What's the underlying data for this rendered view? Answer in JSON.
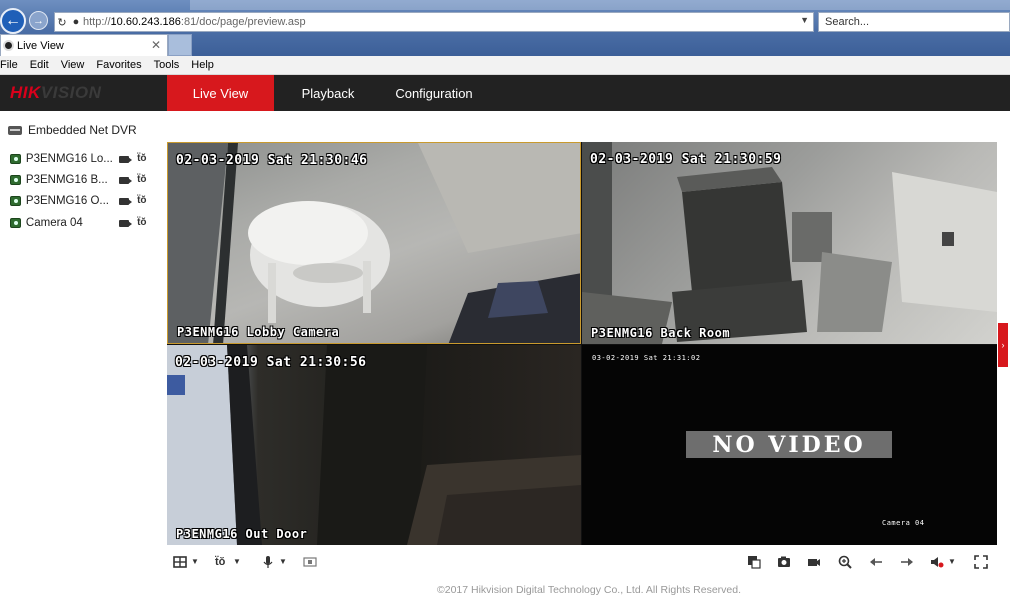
{
  "browser": {
    "url_prefix": "http://",
    "url_host": "10.60.243.186",
    "url_suffix": ":81/doc/page/preview.asp",
    "search_placeholder": "Search...",
    "tab_title": "Live View",
    "tab_close": "✕",
    "menu": [
      "File",
      "Edit",
      "View",
      "Favorites",
      "Tools",
      "Help"
    ]
  },
  "app": {
    "logo_part1": "HIK",
    "logo_part2": "VISION",
    "tabs": [
      "Live View",
      "Playback",
      "Configuration"
    ],
    "active_tab": "Live View",
    "accent_color": "#d7181d"
  },
  "sidebar": {
    "device": "Embedded Net DVR",
    "cameras": [
      {
        "label": "P3ENMG16 Lo..."
      },
      {
        "label": "P3ENMG16 B..."
      },
      {
        "label": "P3ENMG16 O..."
      },
      {
        "label": "Camera 04"
      }
    ]
  },
  "video": {
    "tiles": [
      {
        "timestamp": "02-03-2019 Sat 21:30:46",
        "name": "P3ENMG16 Lobby Camera"
      },
      {
        "timestamp": "02-03-2019 Sat 21:30:59",
        "name": "P3ENMG16 Back Room"
      },
      {
        "timestamp": "02-03-2019 Sat 21:30:56",
        "name": "P3ENMG16 Out Door"
      },
      {
        "timestamp": "03-02-2019 Sat 21:31:02",
        "name": "Camera 04",
        "overlay": "NO VIDEO"
      }
    ]
  },
  "toolbar": {
    "left_icons": [
      "layout-icon",
      "ptz-icon",
      "microphone-icon",
      "stream-icon"
    ],
    "right_icons": [
      "window-icon",
      "snapshot-icon",
      "record-icon",
      "zoom-icon",
      "previous-icon",
      "next-icon",
      "volume-icon",
      "fullscreen-icon"
    ]
  },
  "footer": {
    "copyright": "©2017 Hikvision Digital Technology Co., Ltd. All Rights Reserved."
  }
}
